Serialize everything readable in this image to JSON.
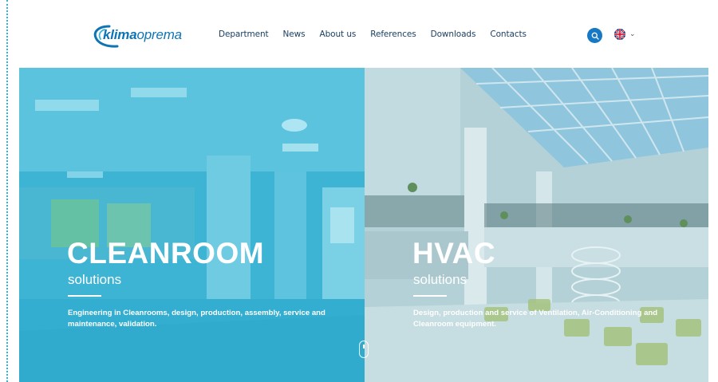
{
  "brand": {
    "logo_accent": "klima",
    "logo_rest": "oprema",
    "color": "#0e74b5"
  },
  "nav": {
    "items": [
      {
        "label": "Department"
      },
      {
        "label": "News"
      },
      {
        "label": "About us"
      },
      {
        "label": "References"
      },
      {
        "label": "Downloads"
      },
      {
        "label": "Contacts"
      }
    ]
  },
  "header": {
    "search_icon": "search-icon",
    "language": {
      "flag": "uk-flag-icon",
      "chevron": "chevron-down-icon"
    }
  },
  "hero": {
    "left": {
      "title": "CLEANROOM",
      "subtitle": "solutions",
      "description": "Engineering in Cleanrooms, design, production, assembly, service and maintenance, validation.",
      "overlay_color": "#3eb4d5"
    },
    "right": {
      "title": "HVAC",
      "subtitle": "solutions",
      "description": "Design, production and service of Ventilation, Air-Conditioning and Cleanroom equipment.",
      "overlay_color": "#a9c8cf"
    },
    "scroll_icon": "mouse-scroll-icon"
  },
  "colors": {
    "nav_text": "#1c3f63",
    "search_button": "#1779c4",
    "edge_dots": "#35b3d6"
  }
}
